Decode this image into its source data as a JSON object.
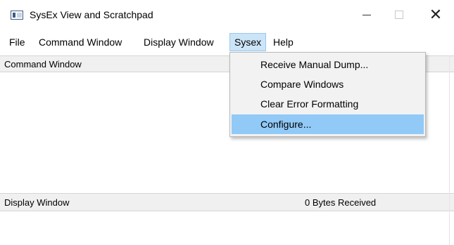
{
  "window": {
    "title": "SysEx View and Scratchpad",
    "minimize_icon": "minimize-icon",
    "maximize_icon": "maximize-icon",
    "close_glyph": "✕"
  },
  "menubar": {
    "items": [
      "File",
      "Command Window",
      "Display Window",
      "Sysex",
      "Help"
    ],
    "active": "Sysex"
  },
  "sysex_menu": {
    "items": [
      {
        "label": "Receive Manual Dump..."
      },
      {
        "label": "Compare Windows"
      },
      {
        "label": "Clear Error Formatting"
      },
      {
        "label": "Configure..."
      }
    ],
    "highlighted": "Configure..."
  },
  "command_window": {
    "title": "Command Window"
  },
  "display_window": {
    "title": "Display Window",
    "status": "0  Bytes Received"
  },
  "colors": {
    "menu_highlight": "#91c9f7",
    "active_menu": "#cce4f7",
    "header_bg": "#f0f0f0"
  }
}
